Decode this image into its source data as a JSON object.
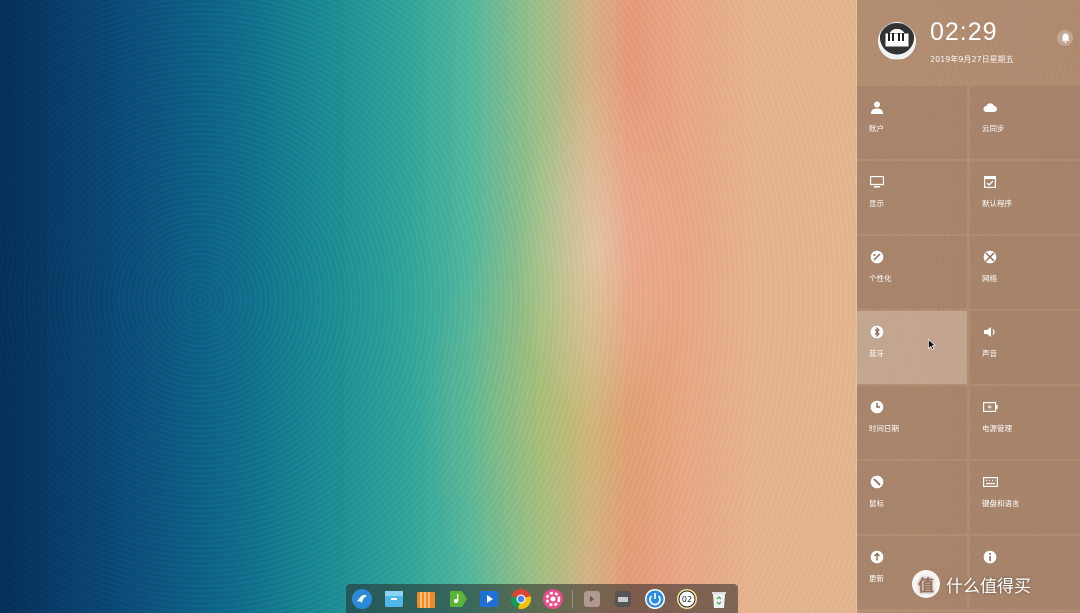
{
  "panel": {
    "time": "02:29",
    "date": "2019年9月27日星期五",
    "tiles": [
      {
        "label": "账户",
        "icon": "user-icon"
      },
      {
        "label": "云同步",
        "icon": "cloud-icon"
      },
      {
        "label": "显示",
        "icon": "monitor-icon"
      },
      {
        "label": "默认程序",
        "icon": "default-apps-icon"
      },
      {
        "label": "个性化",
        "icon": "palette-icon"
      },
      {
        "label": "网络",
        "icon": "network-icon"
      },
      {
        "label": "蓝牙",
        "icon": "bluetooth-icon"
      },
      {
        "label": "声音",
        "icon": "speaker-icon"
      },
      {
        "label": "时间日期",
        "icon": "clock-icon"
      },
      {
        "label": "电源管理",
        "icon": "battery-icon"
      },
      {
        "label": "鼠标",
        "icon": "mouse-icon"
      },
      {
        "label": "键盘和语言",
        "icon": "keyboard-icon"
      },
      {
        "label": "更新",
        "icon": "update-icon"
      },
      {
        "label": "",
        "icon": "info-icon"
      }
    ]
  },
  "dock": {
    "items": [
      "launcher-icon",
      "file-manager-icon",
      "app-store-icon",
      "media-icon",
      "video-player-icon",
      "chrome-icon",
      "settings-icon",
      "tray-icon-1",
      "tray-icon-2",
      "power-icon",
      "clock-tray-icon",
      "trash-icon"
    ]
  },
  "watermark": {
    "logo": "值",
    "text": "什么值得买"
  }
}
